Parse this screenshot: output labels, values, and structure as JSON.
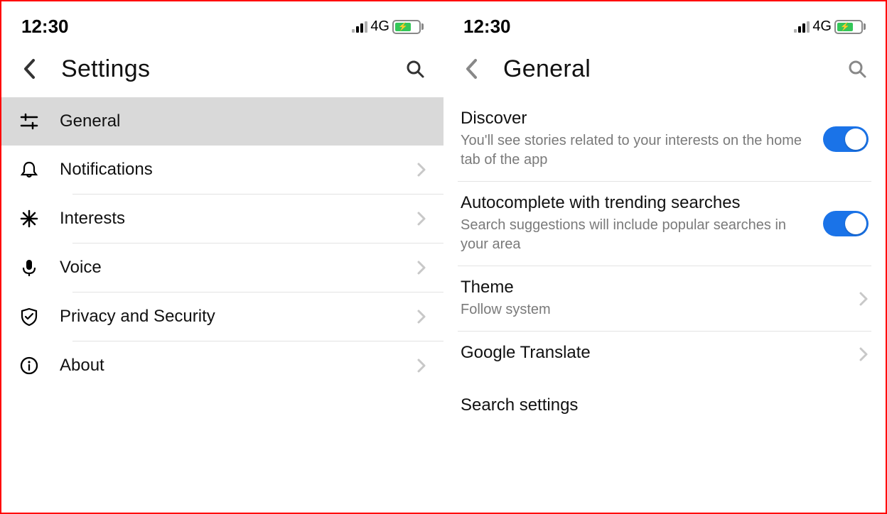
{
  "status": {
    "time": "12:30",
    "network": "4G"
  },
  "left": {
    "title": "Settings",
    "items": [
      {
        "label": "General"
      },
      {
        "label": "Notifications"
      },
      {
        "label": "Interests"
      },
      {
        "label": "Voice"
      },
      {
        "label": "Privacy and Security"
      },
      {
        "label": "About"
      }
    ]
  },
  "right": {
    "title": "General",
    "discover": {
      "title": "Discover",
      "sub": "You'll see stories related to your interests on the home tab of the app"
    },
    "autocomplete": {
      "title": "Autocomplete with trending searches",
      "sub": "Search suggestions will include popular searches in your area"
    },
    "theme": {
      "title": "Theme",
      "sub": "Follow system"
    },
    "translate": {
      "title": "Google Translate"
    },
    "search_settings": {
      "title": "Search settings"
    }
  }
}
